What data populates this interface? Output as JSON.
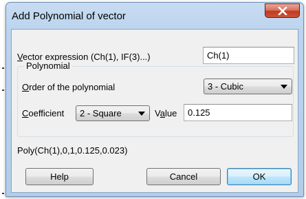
{
  "dialog": {
    "title": "Add Polynomial of vector",
    "close_glyph": "×"
  },
  "vector_expression": {
    "label_underlined": "V",
    "label_rest": "ector expression (Ch(1), IF(3)...)",
    "value": "Ch(1)"
  },
  "polynomial_group": {
    "title": "Polynomial",
    "order_label_underlined": "O",
    "order_label_rest": "rder of the polynomial",
    "order_selected": "3 - Cubic",
    "coefficient_label_underlined": "C",
    "coefficient_label_rest": "oefficient",
    "coefficient_selected": "2 - Square",
    "value_label_before": "V",
    "value_label_underlined": "a",
    "value_label_after": "lue",
    "value": "0.125"
  },
  "formula_preview": "Poly(Ch(1),0,1,0.125,0.023)",
  "buttons": {
    "help": "Help",
    "cancel": "Cancel",
    "ok": "OK"
  },
  "icons": {
    "close": "close-icon",
    "combo_arrow": "chevron-down-icon"
  },
  "colors": {
    "frame": "#bcd4ee",
    "close_button": "#c13c22",
    "client_background": "#f0f0f0",
    "default_button": "#bee6fd"
  }
}
